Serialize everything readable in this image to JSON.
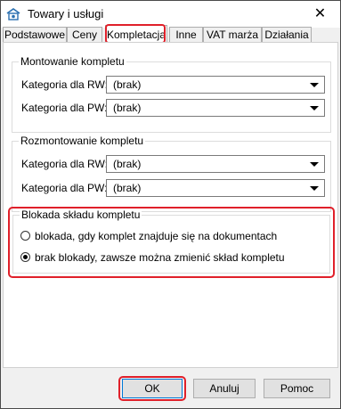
{
  "window": {
    "title": "Towary i usługi",
    "close_glyph": "✕"
  },
  "tabs": [
    {
      "label": "Podstawowe"
    },
    {
      "label": "Ceny"
    },
    {
      "label": "Kompletacja"
    },
    {
      "label": "Inne"
    },
    {
      "label": "VAT marża"
    },
    {
      "label": "Działania"
    }
  ],
  "active_tab": "Kompletacja",
  "montowanie": {
    "legend": "Montowanie kompletu",
    "rw_label": "Kategoria dla RW:",
    "rw_value": "(brak)",
    "pw_label": "Kategoria dla PW:",
    "pw_value": "(brak)"
  },
  "rozmontowanie": {
    "legend": "Rozmontowanie kompletu",
    "rw_label": "Kategoria dla RW:",
    "rw_value": "(brak)",
    "pw_label": "Kategoria dla PW:",
    "pw_value": "(brak)"
  },
  "blokada": {
    "legend": "Blokada składu kompletu",
    "option1": "blokada, gdy komplet znajduje się na dokumentach",
    "option2": "brak blokady, zawsze można zmienić skład kompletu",
    "selected": "option2"
  },
  "buttons": {
    "ok": "OK",
    "cancel": "Anuluj",
    "help": "Pomoc"
  },
  "colors": {
    "highlight": "#e0202a",
    "accent": "#0078d7"
  }
}
